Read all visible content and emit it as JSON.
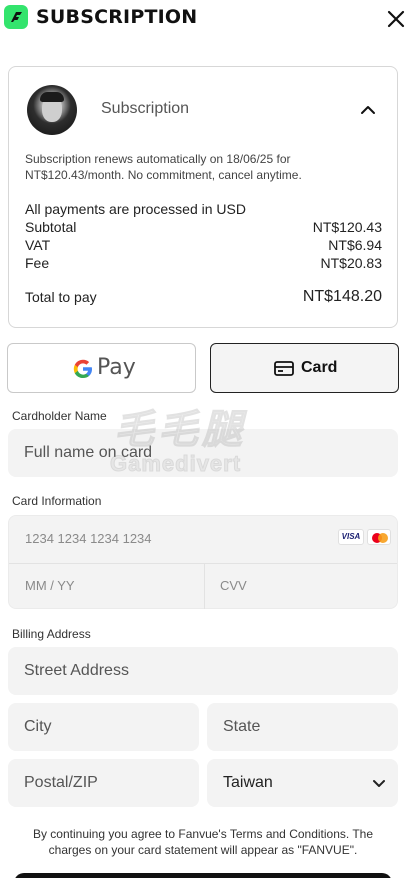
{
  "header": {
    "title": "SUBSCRIPTION",
    "logo_icon": "fanvue-logo-icon",
    "close_icon": "close-icon"
  },
  "summary": {
    "avatar_icon": "creator-avatar",
    "label": "Subscription",
    "toggle_icon": "chevron-up-icon",
    "renew_text": "Subscription renews automatically on 18/06/25 for NT$120.43/month. No commitment, cancel anytime.",
    "currency_note": "All payments are processed in USD",
    "rows": [
      {
        "label": "Subtotal",
        "value": "NT$120.43"
      },
      {
        "label": "VAT",
        "value": "NT$6.94"
      },
      {
        "label": "Fee",
        "value": "NT$20.83"
      }
    ],
    "total": {
      "label": "Total to pay",
      "value": "NT$148.20"
    }
  },
  "payment_methods": {
    "gpay_label": "Pay",
    "card_label": "Card",
    "selected": "Card"
  },
  "form": {
    "cardholder_label": "Cardholder Name",
    "cardholder_placeholder": "Full name on card",
    "card_info_label": "Card Information",
    "card_number_placeholder": "1234 1234 1234 1234",
    "card_brands": [
      "VISA",
      "Mastercard"
    ],
    "expiry_placeholder": "MM / YY",
    "cvv_placeholder": "CVV",
    "billing_label": "Billing Address",
    "street_placeholder": "Street Address",
    "city_placeholder": "City",
    "state_placeholder": "State",
    "zip_placeholder": "Postal/ZIP",
    "country_value": "Taiwan"
  },
  "terms_text": "By continuing you agree to Fanvue's Terms and Conditions. The charges on your card statement will appear as \"FANVUE\".",
  "watermark": {
    "cn": "毛毛腿",
    "en": "Gamedivert"
  },
  "colors": {
    "brand_green": "#33e46d",
    "field_bg": "#f3f3f3",
    "visa_blue": "#1a1f71",
    "mc_red": "#eb001b",
    "mc_orange": "#f79e1b"
  }
}
